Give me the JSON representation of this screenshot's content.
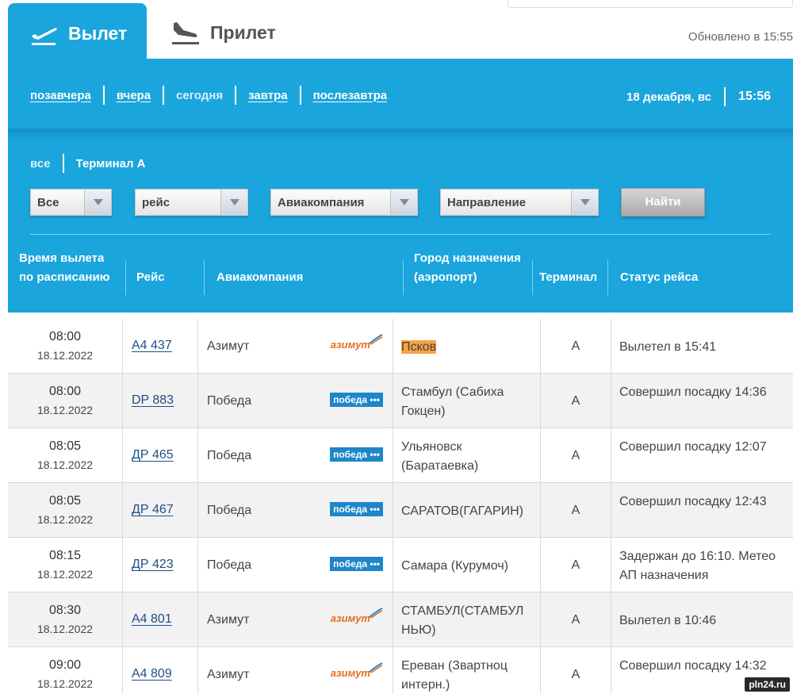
{
  "tabs": {
    "departure": "Вылет",
    "arrival": "Прилет",
    "updated": "Обновлено в 15:55"
  },
  "days": [
    "позавчера",
    "вчера",
    "сегодня",
    "завтра",
    "послезавтра"
  ],
  "current": {
    "date": "18 декабря, вс",
    "time": "15:56"
  },
  "terminals": {
    "all": "все",
    "a": "Терминал А"
  },
  "filters": {
    "type": "Все",
    "flight": "рейс",
    "airline": "Авиакомпания",
    "direction": "Направление",
    "find": "Найти"
  },
  "columns": {
    "time": "Время вылета по расписанию",
    "flight": "Рейс",
    "airline": "Авиакомпания",
    "destination": "Город назначения (аэропорт)",
    "terminal": "Терминал",
    "status": "Статус рейса"
  },
  "logos": {
    "azimut": "азимут",
    "pobeda": "победа"
  },
  "colors": {
    "header": "#1aa5dd",
    "azimut": "#e66b1f",
    "pobeda": "#1e86c9",
    "highlight": "#f6a343"
  },
  "rows": [
    {
      "time": "08:00",
      "date": "18.12.2022",
      "flight": "А4 437",
      "airline": "Азимут",
      "logo": "azimut",
      "destination": "Псков",
      "terminal": "А",
      "status": "Вылетел в 15:41"
    },
    {
      "time": "08:00",
      "date": "18.12.2022",
      "flight": "DP 883",
      "airline": "Победа",
      "logo": "pobeda",
      "destination": "Стамбул (Сабиха Гокцен)",
      "terminal": "А",
      "status": "Совершил посадку 14:36"
    },
    {
      "time": "08:05",
      "date": "18.12.2022",
      "flight": "ДР 465",
      "airline": "Победа",
      "logo": "pobeda",
      "destination": "Ульяновск (Баратаевка)",
      "terminal": "А",
      "status": "Совершил посадку 12:07"
    },
    {
      "time": "08:05",
      "date": "18.12.2022",
      "flight": "ДР 467",
      "airline": "Победа",
      "logo": "pobeda",
      "destination": "САРАТОВ(ГАГАРИН)",
      "terminal": "А",
      "status": "Совершил посадку 12:43"
    },
    {
      "time": "08:15",
      "date": "18.12.2022",
      "flight": "ДР 423",
      "airline": "Победа",
      "logo": "pobeda",
      "destination": "Самара (Курумоч)",
      "terminal": "А",
      "status": "Задержан до 16:10. Метео АП назначения"
    },
    {
      "time": "08:30",
      "date": "18.12.2022",
      "flight": "А4 801",
      "airline": "Азимут",
      "logo": "azimut",
      "destination": "СТАМБУЛ(СТАМБУЛ НЬЮ)",
      "terminal": "А",
      "status": "Вылетел в 10:46"
    },
    {
      "time": "09:00",
      "date": "18.12.2022",
      "flight": "А4 809",
      "airline": "Азимут",
      "logo": "azimut",
      "destination": "Ереван (Звартноц интерн.)",
      "terminal": "А",
      "status": "Совершил посадку 14:32"
    }
  ],
  "watermark": "pln24.ru"
}
